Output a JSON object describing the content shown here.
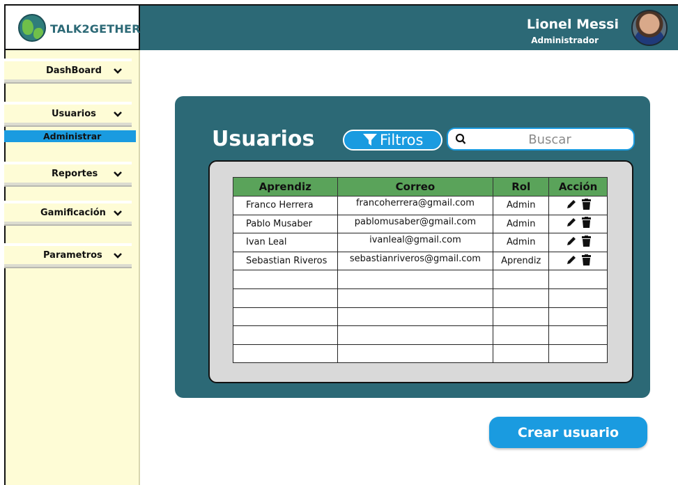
{
  "brand": {
    "name": "TALK2GETHER",
    "icon": "globe-icon"
  },
  "user": {
    "name": "Lionel Messi",
    "role": "Administrador"
  },
  "sidebar": {
    "items": [
      {
        "label": "DashBoard",
        "icon": "chevron-down-icon"
      },
      {
        "label": "Usuarios",
        "icon": "chevron-down-icon"
      },
      {
        "label": "Reportes",
        "icon": "chevron-down-icon"
      },
      {
        "label": "Gamificación",
        "icon": "chevron-down-icon"
      },
      {
        "label": "Parametros",
        "icon": "chevron-down-icon"
      }
    ],
    "active_sub": "Administrar"
  },
  "main": {
    "title": "Usuarios",
    "filter_label": "Filtros",
    "search_placeholder": "Buscar",
    "table": {
      "headers": [
        "Aprendiz",
        "Correo",
        "Rol",
        "Acción"
      ],
      "rows": [
        {
          "name": "Franco Herrera",
          "email": "francoherrera@gmail.com",
          "role": "Admin"
        },
        {
          "name": "Pablo Musaber",
          "email": "pablomusaber@gmail.com",
          "role": "Admin"
        },
        {
          "name": "Ivan Leal",
          "email": "ivanleal@gmail.com",
          "role": "Admin"
        },
        {
          "name": "Sebastian Riveros",
          "email": "sebastianriveros@gmail.com",
          "role": "Aprendiz"
        }
      ],
      "empty_rows": 5
    },
    "create_label": "Crear usuario"
  },
  "colors": {
    "header": "#2c6976",
    "sidebar": "#fefcd6",
    "accent": "#1a9be0",
    "table_header": "#5aa35a"
  }
}
